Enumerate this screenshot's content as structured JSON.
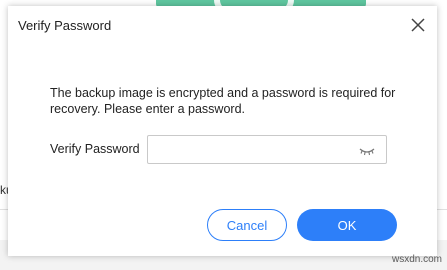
{
  "dialog": {
    "title": "Verify Password",
    "message": "The backup image is encrypted and a password is required for recovery. Please enter a password.",
    "field_label": "Verify Password",
    "password_value": "",
    "password_placeholder": "",
    "cancel_label": "Cancel",
    "ok_label": "OK",
    "close_icon": "close-icon",
    "eye_icon": "eye-closed-icon"
  },
  "background": {
    "partial_text": "ku"
  },
  "watermark": {
    "text": "wsxdn.com"
  },
  "colors": {
    "accent": "#2d7ff9",
    "banner": "#5fc7a0"
  }
}
